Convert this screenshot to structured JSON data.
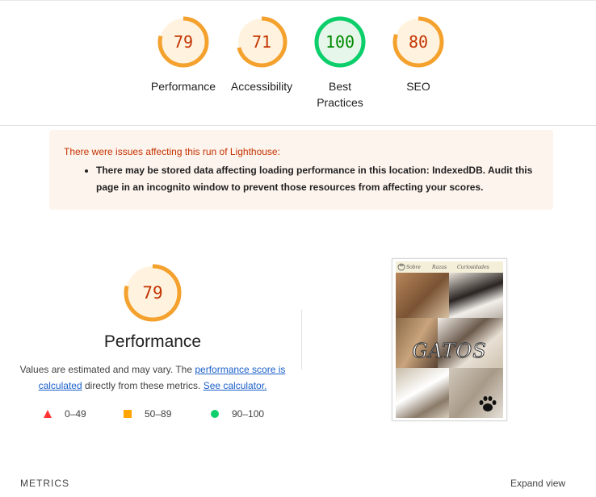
{
  "gauges": [
    {
      "label": "Performance",
      "score": "79",
      "color": "#f4a12d",
      "text_color": "#c33300",
      "fill": "#fff3e0",
      "progress": 0.79
    },
    {
      "label": "Accessibility",
      "score": "71",
      "color": "#f4a12d",
      "text_color": "#c33300",
      "fill": "#fff3e0",
      "progress": 0.71
    },
    {
      "label": "Best Practices",
      "score": "100",
      "color": "#0cce6b",
      "text_color": "#008800",
      "fill": "#e6f6ea",
      "progress": 1.0
    },
    {
      "label": "SEO",
      "score": "80",
      "color": "#f4a12d",
      "text_color": "#c33300",
      "fill": "#fff3e0",
      "progress": 0.8
    }
  ],
  "warning": {
    "title": "There were issues affecting this run of Lighthouse:",
    "items": [
      "There may be stored data affecting loading performance in this location: IndexedDB. Audit this page in an incognito window to prevent those resources from affecting your scores."
    ]
  },
  "performance": {
    "score": "79",
    "progress": 0.79,
    "title": "Performance",
    "desc_prefix": "Values are estimated and may vary. The ",
    "score_link": "performance score is calculated",
    "desc_middle": " directly from these metrics. ",
    "calculator_link": "See calculator."
  },
  "legend": [
    {
      "range": "0–49",
      "shape": "triangle",
      "color": "#ff3333"
    },
    {
      "range": "50–89",
      "shape": "square",
      "color": "#ffa400"
    },
    {
      "range": "90–100",
      "shape": "circle",
      "color": "#0cce6b"
    }
  ],
  "screenshot": {
    "nav": [
      "Sobre",
      "Razas",
      "Curiosidades"
    ],
    "overlay": "GATOS"
  },
  "metrics": {
    "label": "METRICS",
    "expand": "Expand view"
  }
}
